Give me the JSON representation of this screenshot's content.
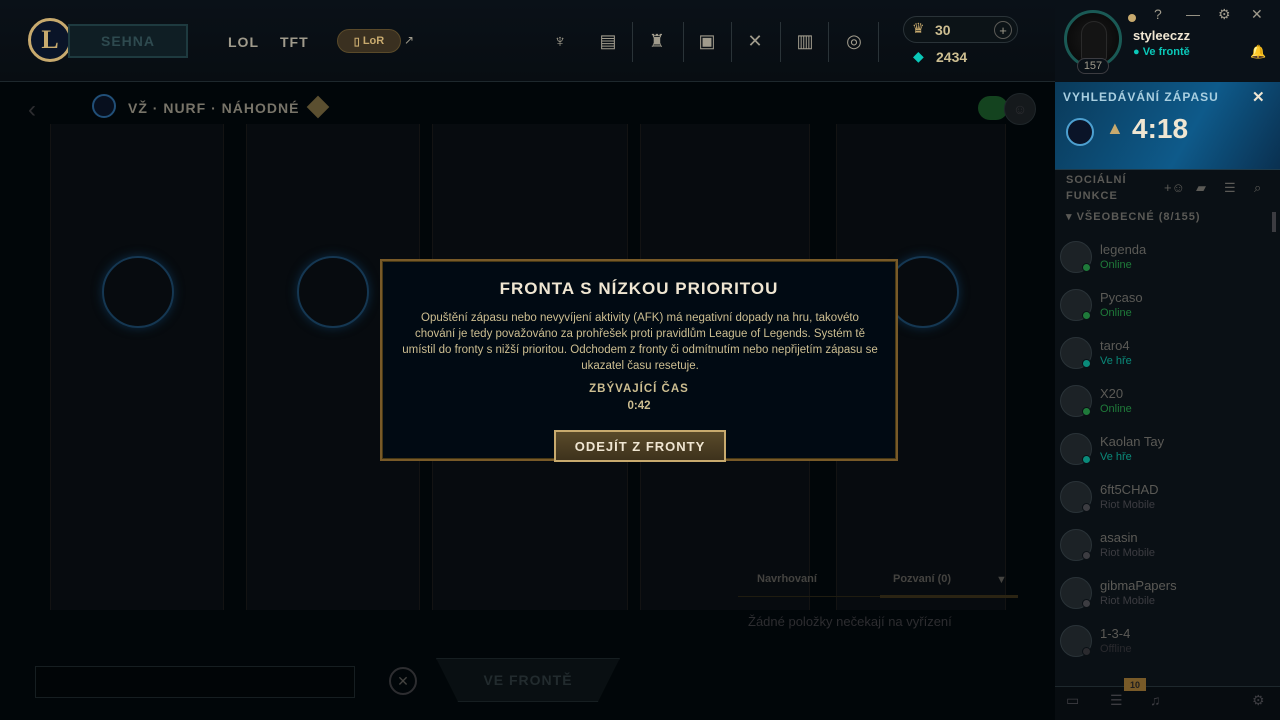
{
  "nav": {
    "play_label": "SEHNA",
    "tabs": [
      "LOL",
      "TFT"
    ],
    "lor_label": "LoR",
    "rp": "30",
    "be": "2434"
  },
  "profile": {
    "name": "styleeczz",
    "status": "Ve frontě",
    "level": "157"
  },
  "lobby": {
    "mode": "VŽ · NURF · NÁHODNÉ",
    "invite_tabs": [
      "Navrhovaní",
      "Pozvaní (0)"
    ],
    "invite_empty": "Žádné položky nečekají na vyřízení",
    "queue_button": "VE FRONTĚ"
  },
  "modal": {
    "title": "FRONTA S NÍZKOU PRIORITOU",
    "body": "Opuštění zápasu nebo nevyvíjení aktivity (AFK) má negativní dopady na hru, takovéto chování je tedy považováno za prohřešek proti pravidlům League of Legends. Systém tě umístil do fronty s nižší prioritou. Odchodem z fronty či odmítnutím nebo nepřijetím zápasu se ukazatel času resetuje.",
    "remaining_label": "ZBÝVAJÍCÍ ČAS",
    "remaining_time": "0:42",
    "button": "ODEJÍT Z FRONTY"
  },
  "sidebar": {
    "match_title": "VYHLEDÁVÁNÍ ZÁPASU",
    "match_time": "4:18",
    "social_title": "SOCIÁLNÍ FUNKCE",
    "group": "VŠEOBECNÉ (8/155)",
    "badge": "10",
    "friends": [
      {
        "name": "legenda",
        "status": "Online",
        "color": "#1f7a3a"
      },
      {
        "name": "Pycaso",
        "status": "Online",
        "color": "#1f7a3a"
      },
      {
        "name": "taro4",
        "status": "Ve hře",
        "color": "#0a8a7a"
      },
      {
        "name": "X20",
        "status": "Online",
        "color": "#1f7a3a"
      },
      {
        "name": "Kaolan Tay",
        "status": "Ve hře",
        "color": "#0a8a7a"
      },
      {
        "name": "6ft5CHAD",
        "status": "Riot Mobile",
        "color": "#3c3c41"
      },
      {
        "name": "asasin",
        "status": "Riot Mobile",
        "color": "#3c3c41"
      },
      {
        "name": "gibmaPapers",
        "status": "Riot Mobile",
        "color": "#3c3c41"
      },
      {
        "name": "1-3-4",
        "status": "Offline",
        "color": "#2a2a2e"
      }
    ]
  },
  "colors": {
    "gold": "#c8aa6e",
    "teal": "#0ac8b9",
    "online": "#1f7a3a"
  }
}
